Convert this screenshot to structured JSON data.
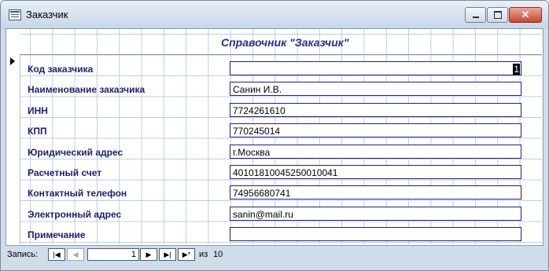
{
  "window": {
    "title": "Заказчик",
    "minimize_icon": "minimize-icon",
    "maximize_icon": "maximize-icon",
    "close_icon": "close-icon",
    "close_glyph": "✕"
  },
  "form": {
    "title": "Справочник \"Заказчик\"",
    "fields": [
      {
        "label": "Код заказчика",
        "value": "1"
      },
      {
        "label": "Наименование заказчика",
        "value": "Санин И.В."
      },
      {
        "label": "ИНН",
        "value": "7724261610"
      },
      {
        "label": "КПП",
        "value": "770245014"
      },
      {
        "label": "Юридический адрес",
        "value": "г.Москва"
      },
      {
        "label": "Расчетный счет",
        "value": "40101810045250010041"
      },
      {
        "label": "Контактный телефон",
        "value": "74956680741"
      },
      {
        "label": "Электронный адрес",
        "value": "sanin@mail.ru"
      },
      {
        "label": "Примечание",
        "value": ""
      }
    ]
  },
  "navigation": {
    "label": "Запись:",
    "first_glyph": "|◀",
    "prev_glyph": "◀",
    "current_record": "1",
    "next_glyph": "▶",
    "last_glyph": "▶|",
    "new_glyph": "▶*",
    "of_label": "из",
    "total_records": "10"
  }
}
